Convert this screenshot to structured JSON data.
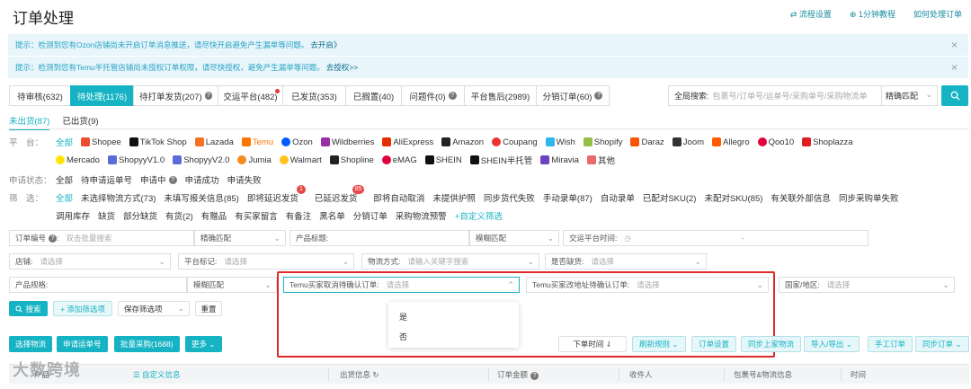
{
  "header": {
    "title": "订单处理",
    "links": [
      "流程设置",
      "1分钟教程",
      "如何处理订单"
    ]
  },
  "notices": [
    {
      "text": "提示：检测到您有Ozon店铺尚未开启订单消息推送，请尽快开启避免产生漏单等问题。",
      "link": "去开启》"
    },
    {
      "text": "提示：检测到您有Temu半托管店铺尚未授权订单权限，请尽快授权，避免产生漏单等问题。",
      "link": "去授权>>"
    }
  ],
  "tabs": [
    {
      "label": "待审核(632)"
    },
    {
      "label": "待处理(1176)"
    },
    {
      "label": "待打单发货(207)"
    },
    {
      "label": "交运平台(482)"
    },
    {
      "label": "已发货(353)"
    },
    {
      "label": "已搁置(40)"
    },
    {
      "label": "问题件(0)"
    },
    {
      "label": "平台售后(2989)"
    },
    {
      "label": "分销订单(60)"
    }
  ],
  "global_search": {
    "label": "全局搜索:",
    "placeholder": "包裹号/订单号/运单号/采购单号/采购物流单",
    "match": "精确匹配"
  },
  "subtabs": [
    "未出货(87)",
    "已出货(9)"
  ],
  "platform_row": {
    "label": "平　台：",
    "items": [
      "全部",
      "Shopee",
      "TikTok Shop",
      "Lazada",
      "Temu",
      "Ozon",
      "Wildberries",
      "AliExpress",
      "Amazon",
      "Coupang",
      "Wish",
      "Shopify",
      "Daraz",
      "Joom",
      "Allegro",
      "Qoo10",
      "Shoplazza"
    ],
    "items2": [
      "Mercado",
      "ShopyyV1.0",
      "ShopyyV2.0",
      "Jumia",
      "Walmart",
      "Shopline",
      "eMAG",
      "SHEIN",
      "SHEIN半托管",
      "Miravia",
      "其他"
    ]
  },
  "apply_row": {
    "label": "申请状态：",
    "items": [
      "全部",
      "待申请运单号",
      "申请中",
      "申请成功",
      "申请失败"
    ]
  },
  "screen_row": {
    "label": "筛　选：",
    "items": [
      "全部",
      "未选择物流方式(73)",
      "未填写报关信息(85)",
      "即将延迟发货",
      "已延迟发货",
      "即将自动取消",
      "未提供护照",
      "同步货代失败",
      "手动录单(87)",
      "自动录单",
      "已配对SKU(2)",
      "未配对SKU(85)",
      "有关联外部信息",
      "同步采购单失败"
    ],
    "badge_upcoming": "1",
    "badge_delayed": "85",
    "items2": [
      "调用库存",
      "缺货",
      "部分缺货",
      "有货(2)",
      "有赠品",
      "有买家留言",
      "有备注",
      "黑名单",
      "分销订单",
      "采购物流预警"
    ],
    "custom": "+自定义筛选"
  },
  "form": {
    "order_no_label": "订单编号",
    "order_no_placeholder": "双击批量搜索",
    "match1": "精确匹配",
    "product_title_label": "产品标题:",
    "match2": "模糊匹配",
    "ship_time_label": "交运平台时间:",
    "ship_time_sep": "-",
    "store_label": "店铺:",
    "store_placeholder": "请选择",
    "platform_tag_label": "平台标记:",
    "platform_tag_placeholder": "请选择",
    "logistics_label": "物流方式:",
    "logistics_placeholder": "请输入关键字搜索",
    "oos_label": "是否缺货:",
    "oos_placeholder": "请选择",
    "spec_label": "产品规格:",
    "match3": "模糊匹配",
    "temu_cancel_label": "Temu买家取消待确认订单:",
    "temu_cancel_placeholder": "请选择",
    "temu_address_label": "Temu买家改地址待确认订单:",
    "temu_address_placeholder": "请选择",
    "country_label": "国家/地区:",
    "country_placeholder": "请选择"
  },
  "form_buttons": {
    "search": "搜索",
    "add_filter": "+ 添加筛选项",
    "save_filter": "保存筛选项",
    "reset": "重置"
  },
  "dropdown_options": [
    "是",
    "否"
  ],
  "toolbar": {
    "select_logistics": "选择物流",
    "apply_waybill": "申请运单号",
    "batch_purchase": "批量采购(1688)",
    "more": "更多",
    "order_time": "下单时间",
    "refresh_rules": "刷新规则",
    "order_settings": "订单设置",
    "sync_logistics": "同步上家物流",
    "import_export": "导入/导出",
    "manual_order": "手工订单",
    "sync_orders": "同步订单"
  },
  "table_headers": [
    "产品",
    "自定义信息",
    "出货信息",
    "订单金额",
    "收件人",
    "包裹号&物流信息",
    "时间"
  ],
  "watermark": "大数跨境",
  "colors": {
    "accent": "#15b3c4",
    "highlight_frame": "#e02a2a",
    "badge": "#e84848"
  }
}
